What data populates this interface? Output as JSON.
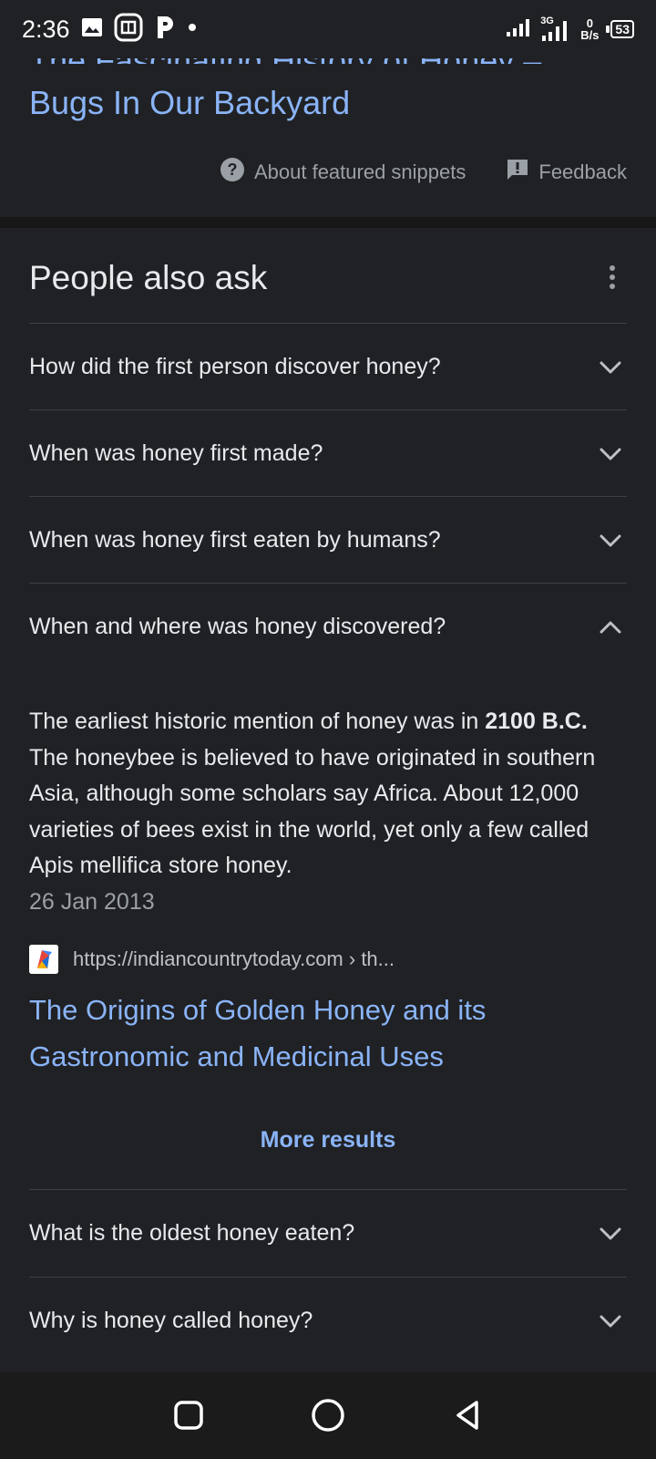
{
  "status": {
    "time": "2:36",
    "network_label": "3G",
    "speed_value": "0",
    "speed_unit": "B/s",
    "battery": "53"
  },
  "snippet": {
    "title_line1": "The Fascinating History of Honey –",
    "title_line2": "Bugs In Our Backyard",
    "about_label": "About featured snippets",
    "feedback_label": "Feedback"
  },
  "paa": {
    "heading": "People also ask",
    "questions": [
      {
        "text": "How did the first person discover honey?"
      },
      {
        "text": "When was honey first made?"
      },
      {
        "text": "When was honey first eaten by humans?"
      },
      {
        "text": "When and where was honey discovered?"
      },
      {
        "text": "What is the oldest honey eaten?"
      },
      {
        "text": "Why is honey called honey?"
      }
    ],
    "answer": {
      "text_before": "The earliest historic mention of honey was in ",
      "bold": "2100 B.C.",
      "text_after": " The honeybee is believed to have originated in southern Asia, although some scholars say Africa. About 12,000 varieties of bees exist in the world, yet only a few called Apis mellifica store honey.",
      "date": "26 Jan 2013"
    },
    "source": {
      "url": "https://indiancountrytoday.com",
      "path": " › th...",
      "title": "The Origins of Golden Honey and its Gastronomic and Medicinal Uses"
    },
    "more_results": "More results"
  },
  "nav": {
    "icons": [
      "recents-icon",
      "home-icon",
      "back-icon"
    ]
  }
}
